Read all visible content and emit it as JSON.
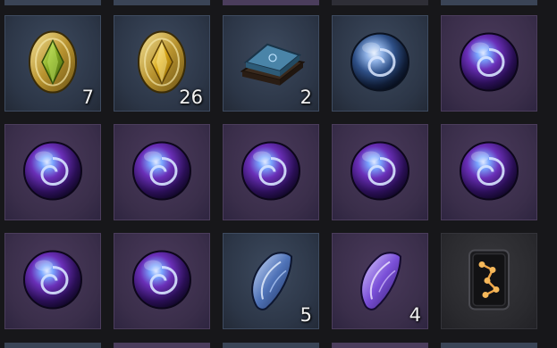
{
  "inventory": {
    "rows": [
      [
        {
          "item": "gem-green-icon",
          "rarity": "blue",
          "count": "7"
        },
        {
          "item": "gem-gold-icon",
          "rarity": "blue",
          "count": "26"
        },
        {
          "item": "stone-tablet-icon",
          "rarity": "blue",
          "count": "2"
        },
        {
          "item": "orb-blue-icon",
          "rarity": "blue",
          "count": ""
        },
        {
          "item": "orb-purple-icon",
          "rarity": "purple",
          "count": ""
        }
      ],
      [
        {
          "item": "orb-purple-icon",
          "rarity": "purple",
          "count": ""
        },
        {
          "item": "orb-purple-icon",
          "rarity": "purple",
          "count": ""
        },
        {
          "item": "orb-purple-icon",
          "rarity": "purple",
          "count": ""
        },
        {
          "item": "orb-purple-icon",
          "rarity": "purple",
          "count": ""
        },
        {
          "item": "orb-purple-icon",
          "rarity": "purple",
          "count": ""
        }
      ],
      [
        {
          "item": "orb-purple-icon",
          "rarity": "purple",
          "count": ""
        },
        {
          "item": "orb-purple-icon",
          "rarity": "purple",
          "count": ""
        },
        {
          "item": "crystal-shard-blue-icon",
          "rarity": "blue",
          "count": "5"
        },
        {
          "item": "crystal-shard-purple-icon",
          "rarity": "purple",
          "count": "4"
        },
        {
          "item": "rune-card-icon",
          "rarity": "dark",
          "count": ""
        }
      ]
    ]
  }
}
